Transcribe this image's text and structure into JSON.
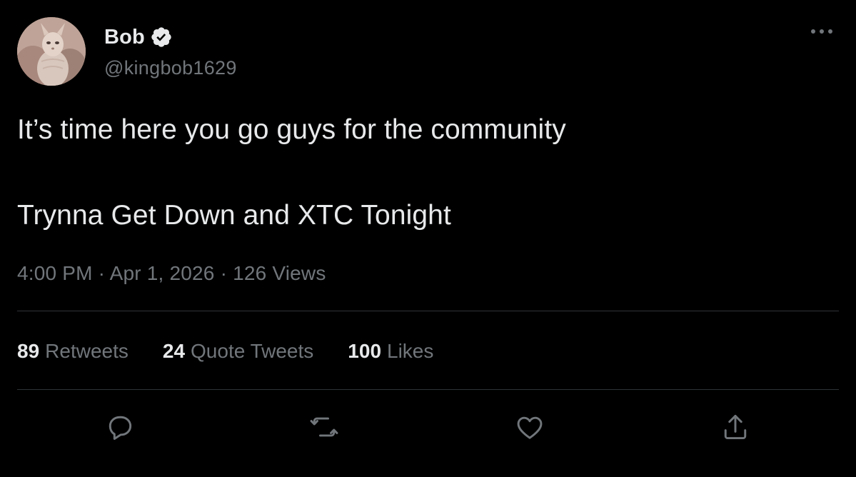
{
  "author": {
    "display_name": "Bob",
    "handle": "@kingbob1629",
    "verified": true,
    "avatar_icon": "avatar-cat-photo"
  },
  "tweet": {
    "lines": [
      "It’s time here you go guys for the community",
      "Trynna Get Down and XTC Tonight"
    ],
    "meta": "4:00 PM · Apr 1, 2026 · 126 Views"
  },
  "stats": [
    {
      "count": "89",
      "label": "Retweets"
    },
    {
      "count": "24",
      "label": "Quote Tweets"
    },
    {
      "count": "100",
      "label": "Likes"
    }
  ],
  "actions": [
    "reply-icon",
    "retweet-icon",
    "like-icon",
    "share-icon"
  ],
  "colors": {
    "background": "#000000",
    "primary_text": "#e7e9ea",
    "secondary_text": "#71767b",
    "divider": "#2f3336"
  }
}
